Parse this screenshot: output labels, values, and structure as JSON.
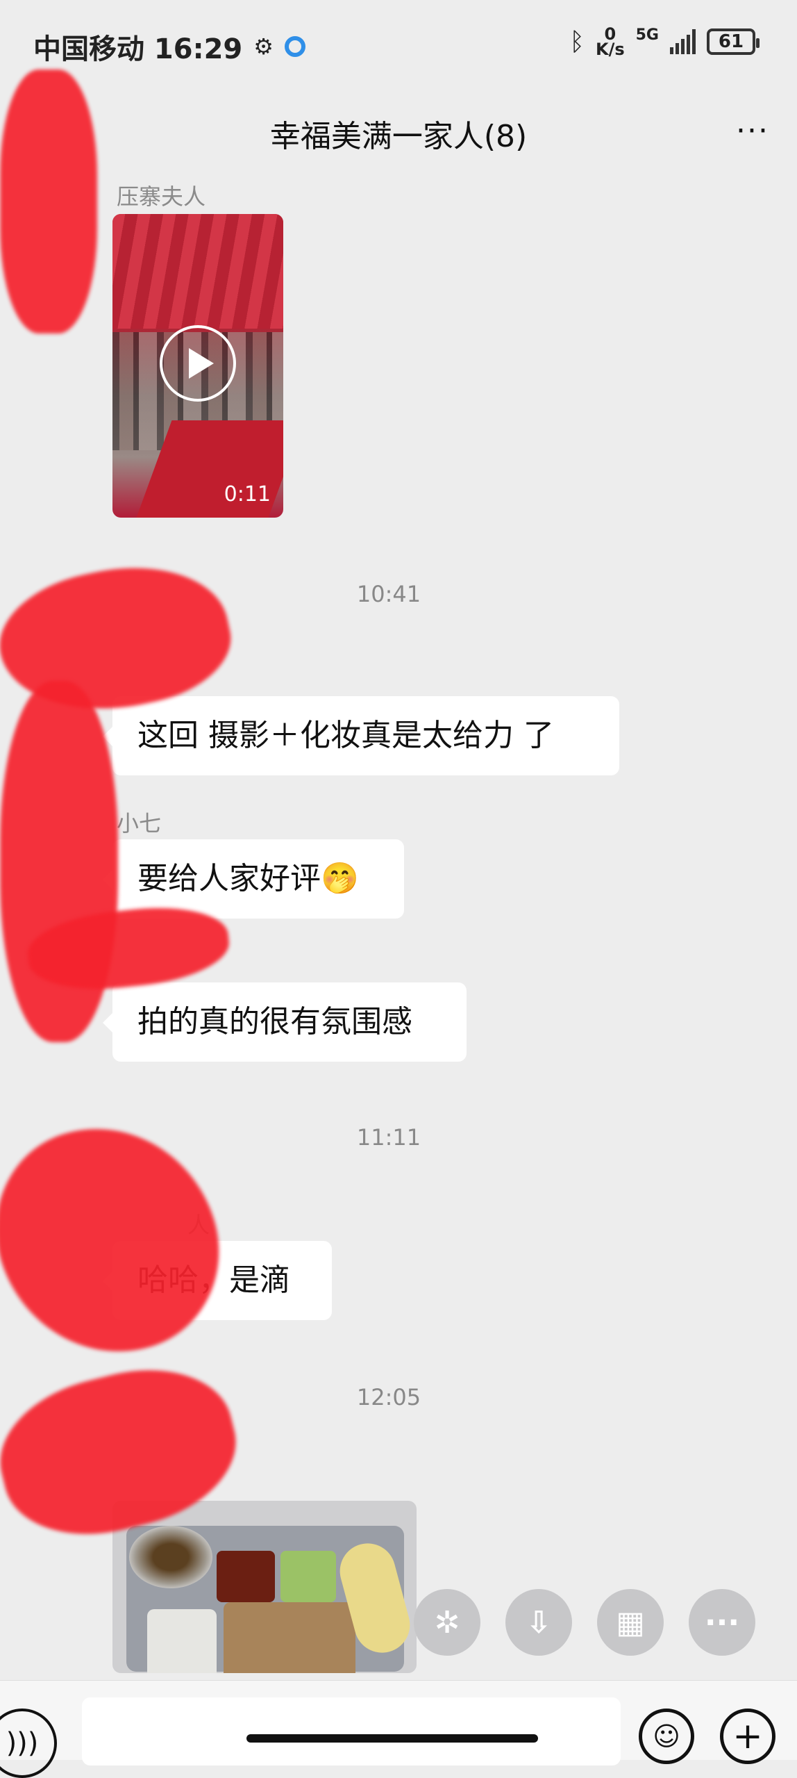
{
  "status_bar": {
    "carrier_time": "中国移动 16:29",
    "net_speed_value": "0",
    "net_speed_unit": "K/s",
    "network": "5G",
    "battery": "61"
  },
  "header": {
    "title": "幸福美满一家人(8)",
    "more": "···"
  },
  "messages": {
    "m1_sender": "压寨夫人",
    "m1_video_duration": "0:11",
    "time1": "10:41",
    "m2_text": "这回 摄影＋化妆真是太给力 了",
    "m3_sender": "小七",
    "m3_text": "要给人家好评🤭",
    "m4_text": "拍的真的很有氛围感",
    "time2": "11:11",
    "m5_sender_partial": "人",
    "m5_text": "哈哈，是滴",
    "time3": "12:05"
  },
  "quick_actions": {
    "icons": [
      "effects-icon",
      "download-icon",
      "grid-icon",
      "more-icon"
    ],
    "more": "···"
  },
  "input_bar": {
    "placeholder": ""
  },
  "colors": {
    "background": "#ededed",
    "bubble": "#ffffff",
    "redaction": "#f5222d"
  }
}
